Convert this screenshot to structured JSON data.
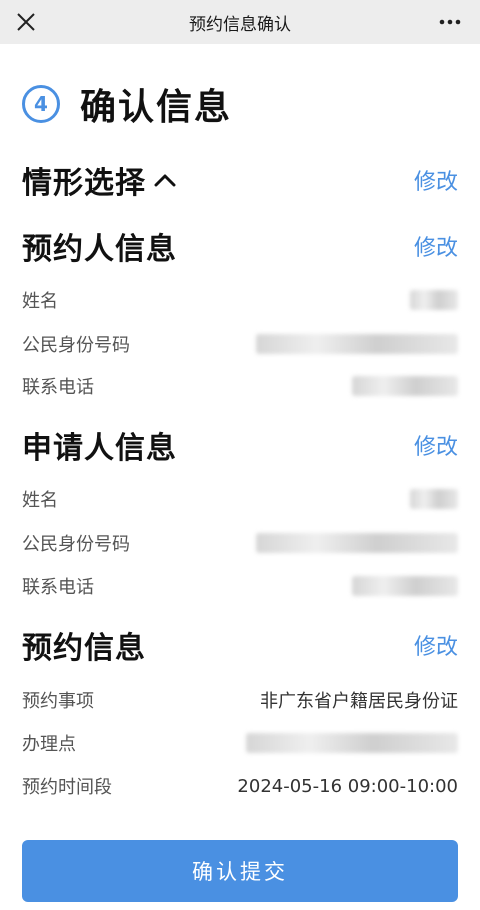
{
  "nav": {
    "title": "预约信息确认",
    "close_icon": "close-icon",
    "more_icon": "more-dots-icon"
  },
  "step": {
    "number": "4",
    "title": "确认信息"
  },
  "situation": {
    "title": "情形选择",
    "edit_label": "修改",
    "chevron_icon": "chevron-up-icon"
  },
  "booker": {
    "title": "预约人信息",
    "edit_label": "修改",
    "rows": [
      {
        "label": "姓名"
      },
      {
        "label": "公民身份号码"
      },
      {
        "label": "联系电话"
      }
    ]
  },
  "applicant": {
    "title": "申请人信息",
    "edit_label": "修改",
    "rows": [
      {
        "label": "姓名"
      },
      {
        "label": "公民身份号码"
      },
      {
        "label": "联系电话"
      }
    ]
  },
  "appointment": {
    "title": "预约信息",
    "edit_label": "修改",
    "rows": [
      {
        "label": "预约事项",
        "value": "非广东省户籍居民身份证"
      },
      {
        "label": "办理点"
      },
      {
        "label": "预约时间段",
        "value": "2024-05-16 09:00-10:00"
      }
    ]
  },
  "submit_label": "确认提交",
  "colors": {
    "accent": "#4a90e2",
    "nav_bg": "#ededed"
  }
}
